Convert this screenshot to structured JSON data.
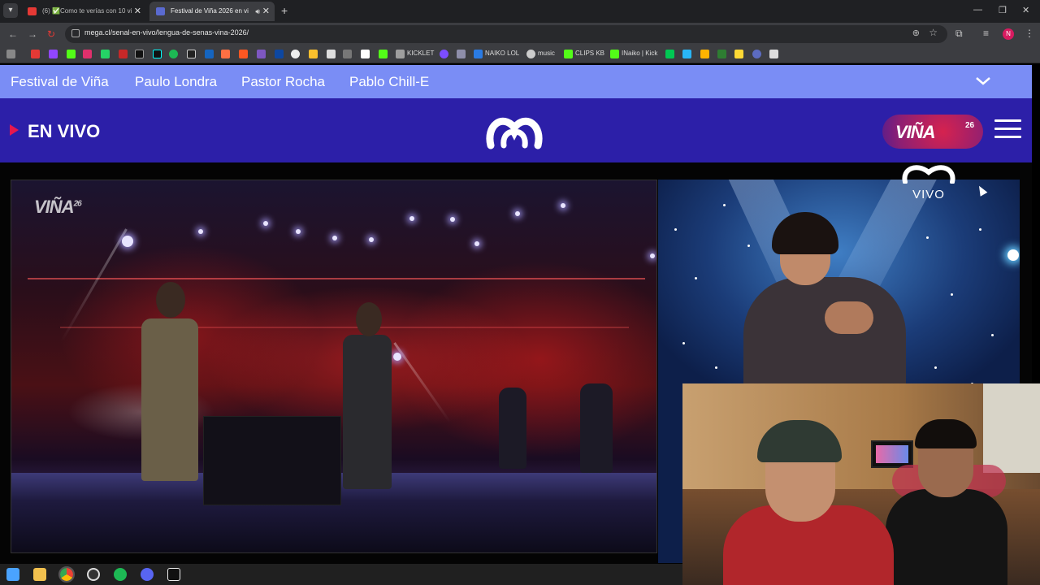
{
  "browser": {
    "tabs": [
      {
        "title": "(6) ✅Como te verías con 10 vi",
        "favicon_color": "#e53935",
        "active": false
      },
      {
        "title": "Festival de Viña 2026 en vi",
        "favicon_color": "#5a6ad0",
        "active": true
      }
    ],
    "new_tab_glyph": "+",
    "url": "mega.cl/senal-en-vivo/lengua-de-senas-vina-2026/",
    "bookmarks": [
      {
        "label": "KICKLET",
        "icon": "kicklet-icon",
        "color": "#9e9e9e"
      },
      {
        "label": "NAIKO LOL",
        "icon": "naiko-lol-icon",
        "color": "#2a7be4"
      },
      {
        "label": "music",
        "icon": "music-icon",
        "color": "#cccccc"
      },
      {
        "label": "CLIPS KB",
        "icon": "clips-kb-icon",
        "color": "#53fc18"
      },
      {
        "label": "INaiko | Kick",
        "icon": "kick-icon",
        "color": "#53fc18"
      }
    ]
  },
  "site": {
    "topnav": [
      "Festival de Viña",
      "Paulo Londra",
      "Pastor Rocha",
      "Pablo Chill-E"
    ],
    "live_label": "EN VIVO",
    "badge_text": "VIÑA",
    "badge_year": "26",
    "colors": {
      "topnav": "#7a8df5",
      "header": "#2c1fa8",
      "live": "#e5174e"
    }
  },
  "player": {
    "stage_watermark": "VIÑA",
    "stage_watermark_year": "26",
    "channel_label": "VIVO"
  }
}
